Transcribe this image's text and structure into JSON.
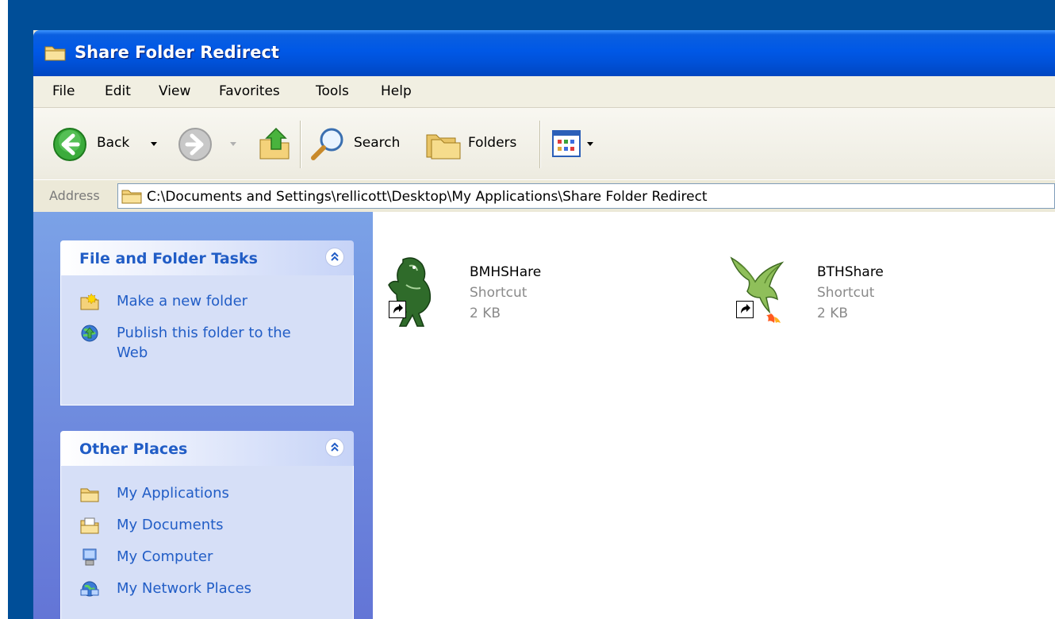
{
  "window": {
    "title": "Share Folder Redirect"
  },
  "menubar": {
    "items": [
      "File",
      "Edit",
      "View",
      "Favorites",
      "Tools",
      "Help"
    ]
  },
  "toolbar": {
    "back_label": "Back",
    "search_label": "Search",
    "folders_label": "Folders"
  },
  "address": {
    "label": "Address",
    "path": "C:\\Documents and Settings\\rellicott\\Desktop\\My Applications\\Share Folder Redirect"
  },
  "taskpane": {
    "file_tasks": {
      "title": "File and Folder Tasks",
      "links": [
        {
          "label": "Make a new folder",
          "icon": "new-folder-icon"
        },
        {
          "label": "Publish this folder to the Web",
          "icon": "publish-web-icon"
        }
      ]
    },
    "other_places": {
      "title": "Other Places",
      "links": [
        {
          "label": "My Applications",
          "icon": "folder-icon"
        },
        {
          "label": "My Documents",
          "icon": "my-documents-icon"
        },
        {
          "label": "My Computer",
          "icon": "my-computer-icon"
        },
        {
          "label": "My Network Places",
          "icon": "network-places-icon"
        }
      ]
    }
  },
  "files": [
    {
      "name": "BMHSHare",
      "type": "Shortcut",
      "size": "2 KB",
      "icon": "horse-shortcut-icon"
    },
    {
      "name": "BTHShare",
      "type": "Shortcut",
      "size": "2 KB",
      "icon": "dragon-shortcut-icon"
    }
  ],
  "colors": {
    "titlebar_blue": "#0058e6",
    "taskpane_link": "#215dc6",
    "desktop": "#004e98"
  }
}
